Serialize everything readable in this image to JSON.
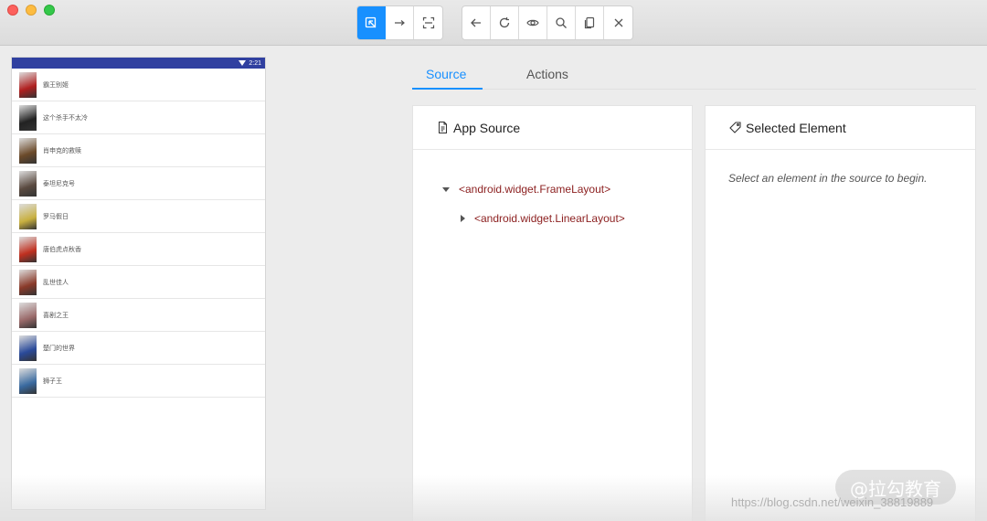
{
  "toolbar": {
    "mode_buttons": [
      "select-element",
      "swipe",
      "tap-by-coordinates"
    ],
    "action_buttons": [
      "back",
      "refresh",
      "show-hide",
      "search",
      "copy",
      "close"
    ]
  },
  "device": {
    "status_time": "2:21",
    "movies": [
      {
        "title": "霸王别姬",
        "color": "#b02020"
      },
      {
        "title": "这个杀手不太冷",
        "color": "#222222"
      },
      {
        "title": "肖申克的救赎",
        "color": "#6b4a2a"
      },
      {
        "title": "泰坦尼克号",
        "color": "#5a4a40"
      },
      {
        "title": "罗马假日",
        "color": "#c8b040"
      },
      {
        "title": "唐伯虎点秋香",
        "color": "#c03020"
      },
      {
        "title": "乱世佳人",
        "color": "#8a3a2a"
      },
      {
        "title": "喜剧之王",
        "color": "#9a6a6a"
      },
      {
        "title": "楚门的世界",
        "color": "#2a4a9a"
      },
      {
        "title": "狮子王",
        "color": "#3a6aa0"
      }
    ]
  },
  "tabs": {
    "source": "Source",
    "actions": "Actions"
  },
  "source_panel": {
    "title": "App Source",
    "tree": [
      {
        "label": "<android.widget.FrameLayout>",
        "expanded": true
      },
      {
        "label": "<android.widget.LinearLayout>",
        "expanded": false
      }
    ]
  },
  "selected_panel": {
    "title": "Selected Element",
    "empty_message": "Select an element in the source to begin."
  },
  "watermark": {
    "badge": "@拉勾教育",
    "url": "https://blog.csdn.net/weixin_38819889"
  },
  "colors": {
    "accent": "#1890ff",
    "status_bar": "#3040a0",
    "tree_text": "#8b1e1e"
  }
}
